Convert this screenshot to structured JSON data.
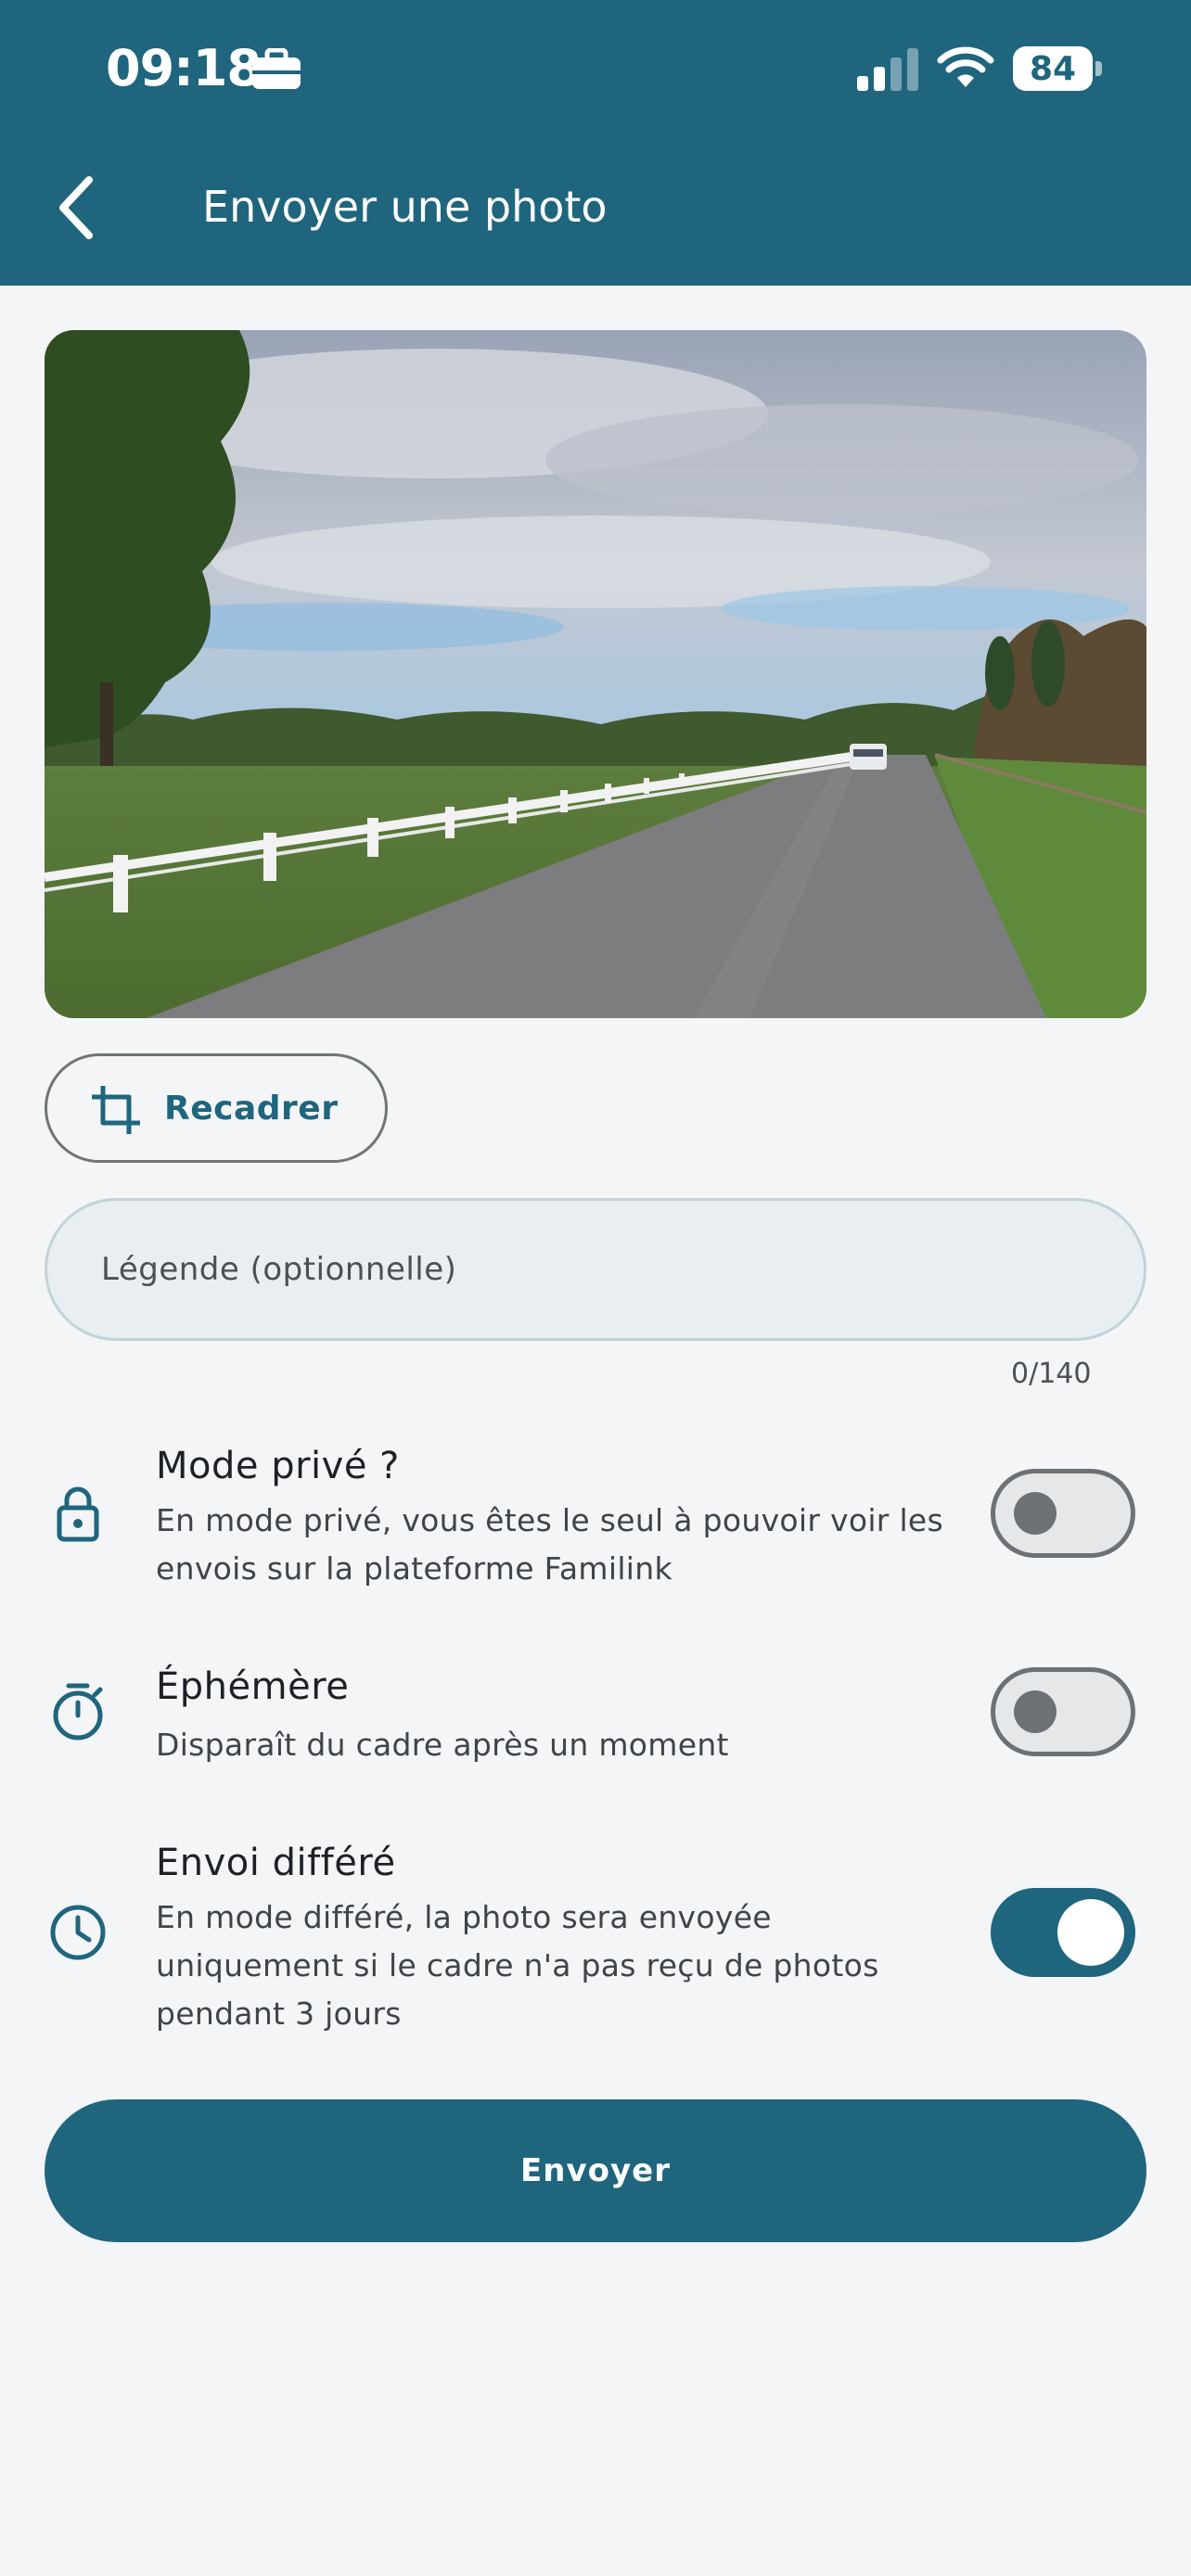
{
  "status_bar": {
    "time": "09:18",
    "battery": "84",
    "icons": [
      "briefcase-icon",
      "signal-icon",
      "wifi-icon",
      "battery-icon"
    ]
  },
  "header": {
    "title": "Envoyer une photo",
    "back_icon": "chevron-left-icon"
  },
  "photo": {
    "description_icon": "photo-preview"
  },
  "crop_button": {
    "label": "Recadrer",
    "icon": "crop-icon"
  },
  "caption": {
    "placeholder": "Légende (optionnelle)",
    "value": "",
    "counter": "0/140"
  },
  "options": [
    {
      "icon": "lock-icon",
      "title": "Mode privé ?",
      "description": "En mode privé, vous êtes le seul à pouvoir voir les envois sur la plateforme Familink",
      "enabled": false
    },
    {
      "icon": "timer-icon",
      "title": "Éphémère",
      "description": "Disparaît du cadre après un moment",
      "enabled": false
    },
    {
      "icon": "clock-icon",
      "title": "Envoi différé",
      "description": "En mode différé, la photo sera envoyée uniquement si le cadre n'a pas reçu de photos pendant 3 jours",
      "enabled": true
    }
  ],
  "send_button": {
    "label": "Envoyer"
  },
  "colors": {
    "primary": "#1f657e",
    "background": "#f3f5f7",
    "input_background": "#e8eef1",
    "toggle_off": "#e6e7e9"
  }
}
